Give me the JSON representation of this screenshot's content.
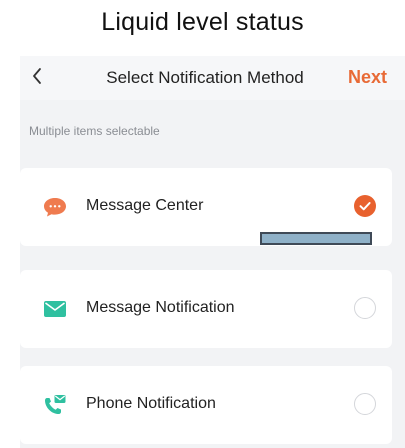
{
  "caption": "Liquid level status",
  "navbar": {
    "back_icon": "chevron-left-icon",
    "title": "Select Notification Method",
    "next_label": "Next"
  },
  "hint": "Multiple items selectable",
  "options": [
    {
      "label": "Message Center",
      "icon": "chat-bubble-icon",
      "selected": true
    },
    {
      "label": "Message Notification",
      "icon": "envelope-icon",
      "selected": false
    },
    {
      "label": "Phone Notification",
      "icon": "phone-mail-icon",
      "selected": false
    }
  ],
  "colors": {
    "accent": "#e8612e",
    "next": "#e86a36",
    "green": "#2fc0a0",
    "background": "#f2f3f5"
  }
}
